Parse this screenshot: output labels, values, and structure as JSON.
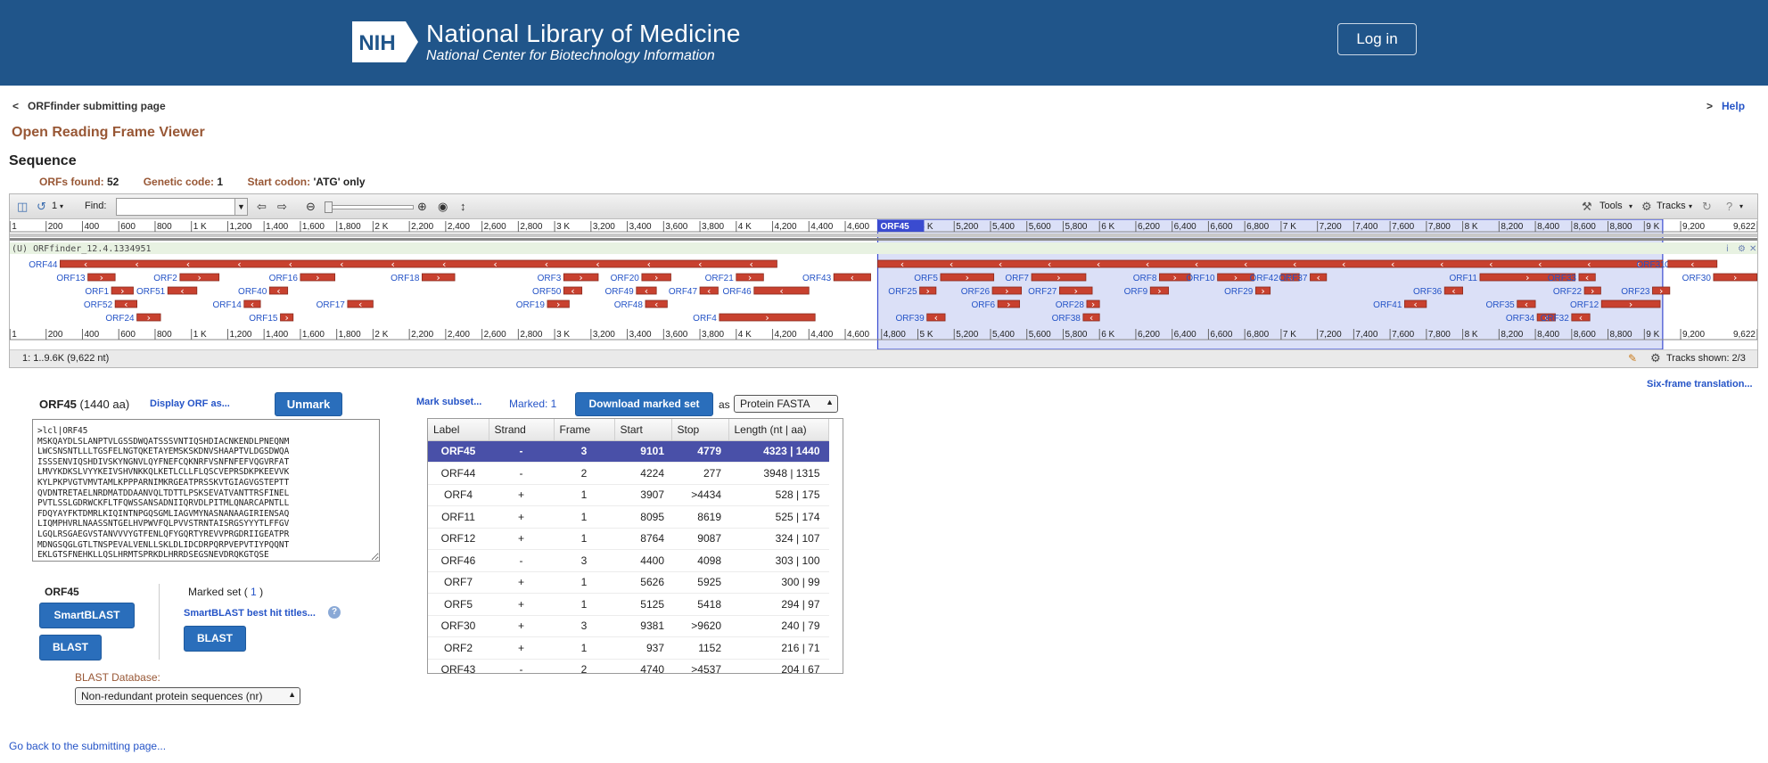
{
  "header": {
    "org_title": "National Library of Medicine",
    "org_subtitle": "National Center for Biotechnology Information",
    "logo_text": "NIH",
    "login_label": "Log in"
  },
  "nav": {
    "back_arrow": "<",
    "back_label": "ORFfinder submitting page",
    "help_arrow": ">",
    "help_label": "Help"
  },
  "page_title": "Open Reading Frame Viewer",
  "section_title": "Sequence",
  "meta": {
    "orfs_found_label": "ORFs found:",
    "orfs_found_value": "52",
    "genetic_code_label": "Genetic code:",
    "genetic_code_value": "1",
    "start_codon_label": "Start codon:",
    "start_codon_value": "'ATG' only"
  },
  "viewer": {
    "toolbar": {
      "undo_count": "1",
      "find_label": "Find:",
      "find_value": "",
      "tools_label": "Tools",
      "tracks_label": "Tracks"
    },
    "ruler_ticks": [
      "1",
      "200",
      "400",
      "600",
      "800",
      "1 K",
      "1,200",
      "1,400",
      "1,600",
      "1,800",
      "2 K",
      "2,200",
      "2,400",
      "2,600",
      "2,800",
      "3 K",
      "3,200",
      "3,400",
      "3,600",
      "3,800",
      "4 K",
      "4,200",
      "4,400",
      "4,600",
      "4,800",
      "5 K",
      "5,200",
      "5,400",
      "5,600",
      "5,800",
      "6 K",
      "6,200",
      "6,400",
      "6,600",
      "6,800",
      "7 K",
      "7,200",
      "7,400",
      "7,600",
      "7,800",
      "8 K",
      "8,200",
      "8,400",
      "8,600",
      "8,800",
      "9 K",
      "9,200",
      "9,622"
    ],
    "sequence_length": 9622,
    "selection": {
      "label": "ORF45",
      "start": 4779,
      "stop": 9101
    },
    "track_title": "(U) ORFfinder_12.4.1334951",
    "status_text": "1: 1..9.6K (9,622 nt)",
    "tracks_shown": "Tracks shown: 2/3",
    "orf_features": [
      {
        "label": "ORF44",
        "start": 277,
        "stop": 4224,
        "row": 0,
        "strand": "-"
      },
      {
        "label": "ORF45",
        "start": 4779,
        "stop": 9101,
        "row": 0,
        "strand": "-"
      },
      {
        "label": "ORF31",
        "start": 9130,
        "stop": 9400,
        "row": 0,
        "strand": "-"
      },
      {
        "label": "ORF13",
        "start": 430,
        "stop": 580,
        "row": 1,
        "strand": "+"
      },
      {
        "label": "ORF2",
        "start": 937,
        "stop": 1152,
        "row": 1,
        "strand": "+"
      },
      {
        "label": "ORF16",
        "start": 1600,
        "stop": 1790,
        "row": 1,
        "strand": "+"
      },
      {
        "label": "ORF18",
        "start": 2270,
        "stop": 2450,
        "row": 1,
        "strand": "+"
      },
      {
        "label": "ORF3",
        "start": 3050,
        "stop": 3240,
        "row": 1,
        "strand": "+"
      },
      {
        "label": "ORF20",
        "start": 3480,
        "stop": 3640,
        "row": 1,
        "strand": "+"
      },
      {
        "label": "ORF21",
        "start": 4000,
        "stop": 4150,
        "row": 1,
        "strand": "+"
      },
      {
        "label": "ORF43",
        "start": 4537,
        "stop": 4740,
        "row": 1,
        "strand": "-"
      },
      {
        "label": "ORF5",
        "start": 5125,
        "stop": 5418,
        "row": 1,
        "strand": "+"
      },
      {
        "label": "ORF7",
        "start": 5626,
        "stop": 5925,
        "row": 1,
        "strand": "+"
      },
      {
        "label": "ORF8",
        "start": 6330,
        "stop": 6500,
        "row": 1,
        "strand": "+"
      },
      {
        "label": "ORF10",
        "start": 6650,
        "stop": 6850,
        "row": 1,
        "strand": "+"
      },
      {
        "label": "ORF42",
        "start": 7000,
        "stop": 7100,
        "row": 1,
        "strand": "-"
      },
      {
        "label": "ORF37",
        "start": 7160,
        "stop": 7250,
        "row": 1,
        "strand": "-"
      },
      {
        "label": "ORF11",
        "start": 8095,
        "stop": 8619,
        "row": 1,
        "strand": "+"
      },
      {
        "label": "ORF33",
        "start": 8640,
        "stop": 8730,
        "row": 1,
        "strand": "-"
      },
      {
        "label": "ORF30",
        "start": 9381,
        "stop": 9620,
        "row": 1,
        "strand": "+"
      },
      {
        "label": "ORF1",
        "start": 560,
        "stop": 680,
        "row": 2,
        "strand": "+"
      },
      {
        "label": "ORF51",
        "start": 870,
        "stop": 1030,
        "row": 2,
        "strand": "-"
      },
      {
        "label": "ORF40",
        "start": 1430,
        "stop": 1530,
        "row": 2,
        "strand": "-"
      },
      {
        "label": "ORF50",
        "start": 3050,
        "stop": 3150,
        "row": 2,
        "strand": "-"
      },
      {
        "label": "ORF49",
        "start": 3450,
        "stop": 3560,
        "row": 2,
        "strand": "-"
      },
      {
        "label": "ORF47",
        "start": 3800,
        "stop": 3900,
        "row": 2,
        "strand": "-"
      },
      {
        "label": "ORF46",
        "start": 4098,
        "stop": 4400,
        "row": 2,
        "strand": "-"
      },
      {
        "label": "ORF25",
        "start": 5010,
        "stop": 5100,
        "row": 2,
        "strand": "+"
      },
      {
        "label": "ORF26",
        "start": 5410,
        "stop": 5570,
        "row": 2,
        "strand": "+"
      },
      {
        "label": "ORF27",
        "start": 5780,
        "stop": 5960,
        "row": 2,
        "strand": "+"
      },
      {
        "label": "ORF9",
        "start": 6280,
        "stop": 6380,
        "row": 2,
        "strand": "+"
      },
      {
        "label": "ORF29",
        "start": 6860,
        "stop": 6940,
        "row": 2,
        "strand": "+"
      },
      {
        "label": "ORF36",
        "start": 7900,
        "stop": 8000,
        "row": 2,
        "strand": "-"
      },
      {
        "label": "ORF22",
        "start": 8670,
        "stop": 8760,
        "row": 2,
        "strand": "+"
      },
      {
        "label": "ORF23",
        "start": 9045,
        "stop": 9140,
        "row": 2,
        "strand": "+"
      },
      {
        "label": "ORF52",
        "start": 580,
        "stop": 700,
        "row": 3,
        "strand": "-"
      },
      {
        "label": "ORF14",
        "start": 1290,
        "stop": 1380,
        "row": 3,
        "strand": "-"
      },
      {
        "label": "ORF17",
        "start": 1860,
        "stop": 2000,
        "row": 3,
        "strand": "-"
      },
      {
        "label": "ORF19",
        "start": 2960,
        "stop": 3080,
        "row": 3,
        "strand": "+"
      },
      {
        "label": "ORF48",
        "start": 3500,
        "stop": 3620,
        "row": 3,
        "strand": "-"
      },
      {
        "label": "ORF6",
        "start": 5440,
        "stop": 5560,
        "row": 3,
        "strand": "+"
      },
      {
        "label": "ORF28",
        "start": 5930,
        "stop": 6000,
        "row": 3,
        "strand": "+"
      },
      {
        "label": "ORF41",
        "start": 7680,
        "stop": 7800,
        "row": 3,
        "strand": "-"
      },
      {
        "label": "ORF35",
        "start": 8300,
        "stop": 8400,
        "row": 3,
        "strand": "-"
      },
      {
        "label": "ORF12",
        "start": 8764,
        "stop": 9087,
        "row": 3,
        "strand": "+"
      },
      {
        "label": "ORF24",
        "start": 700,
        "stop": 830,
        "row": 4,
        "strand": "+"
      },
      {
        "label": "ORF15",
        "start": 1490,
        "stop": 1560,
        "row": 4,
        "strand": "+"
      },
      {
        "label": "ORF4",
        "start": 3907,
        "stop": 4434,
        "row": 4,
        "strand": "+"
      },
      {
        "label": "ORF39",
        "start": 5050,
        "stop": 5150,
        "row": 4,
        "strand": "-"
      },
      {
        "label": "ORF38",
        "start": 5910,
        "stop": 6000,
        "row": 4,
        "strand": "-"
      },
      {
        "label": "ORF34",
        "start": 8410,
        "stop": 8510,
        "row": 4,
        "strand": "-"
      },
      {
        "label": "ORF32",
        "start": 8600,
        "stop": 8700,
        "row": 4,
        "strand": "-"
      }
    ]
  },
  "orf_panel": {
    "orf_name": "ORF45",
    "orf_len": "(1440 aa)",
    "display_link": "Display ORF as...",
    "unmark_label": "Unmark",
    "sequence_text": ">lcl|ORF45\nMSKQAYDLSLANPTVLGSSDWQATSSSVNTIQSHDIACNKENDLPNEQNM\nLWCSNSNTLLLTGSFELNGTQKETAYEMSKSKDNVSHAAPTVLDGSDWQA\nISSSENVIQSHDIVSKYNGNVLQYFNEFCQKNRFVSNFNFEFVQGVRFAT\nLMVYKDKSLVYYKEIVSHVNKKQLKETLCLLFLQSCVEPRSDKPKEEVVK\nKYLPKPVGTVMVTAMLKPPPARNIMKRGEATPRSSKVTGIAGVGSTEPTT\nQVDNTRETAELNRDMATDDAANVQLTDTTLPSKSEVATVANTTRSFINEL\nPVTLSSLGDRWCKFLTFQWSSANSADNIIQRVDLPITMLQNARCAPNTLL\nFDQYAYFKTDMRLKIQINTNPGQSGMLIAGVMYNASNANAAGIRIENSAQ\nLIQMPHVRLNAASSNTGELHVPWVFQLPVVSTRNTAISRGSYYYTLFFGV\nLGQLRSGAEGVSTANVVVYGTFENLQFYGQRTYREVVPRGDRIIGEATPR\nMDNGSQGLGTLTNSPEVALVENLLSKLDLIDCDRPQRPVEPVTIYPQQNT\nEKLGTSFNEHKLLQSLHRMTSPRKDLHRRDSEGSNEVDRQKGTQSE",
    "blast_orf_label": "ORF45",
    "smartblast_label": "SmartBLAST",
    "blast_label": "BLAST",
    "marked_set_label": "Marked set (",
    "marked_set_count": "1",
    "marked_set_close": ")",
    "smartblast_titles": "SmartBLAST best hit titles...",
    "help_symbol": "?",
    "blast_marked_label": "BLAST",
    "blast_db_label": "BLAST Database:",
    "blast_db_value": "Non-redundant protein sequences (nr)"
  },
  "marked_panel": {
    "mark_subset": "Mark subset...",
    "marked_label": "Marked: 1",
    "download_label": "Download marked set",
    "as_label": "as",
    "format_value": "Protein FASTA",
    "six_frame": "Six-frame translation..."
  },
  "orf_table": {
    "columns": [
      "Label",
      "Strand",
      "Frame",
      "Start",
      "Stop",
      "Length (nt | aa)"
    ],
    "rows": [
      {
        "label": "ORF45",
        "strand": "-",
        "frame": "3",
        "start": "9101",
        "stop": "4779",
        "length": "4323 | 1440",
        "selected": true
      },
      {
        "label": "ORF44",
        "strand": "-",
        "frame": "2",
        "start": "4224",
        "stop": "277",
        "length": "3948 | 1315"
      },
      {
        "label": "ORF4",
        "strand": "+",
        "frame": "1",
        "start": "3907",
        "stop": ">4434",
        "length": "528 | 175"
      },
      {
        "label": "ORF11",
        "strand": "+",
        "frame": "1",
        "start": "8095",
        "stop": "8619",
        "length": "525 | 174"
      },
      {
        "label": "ORF12",
        "strand": "+",
        "frame": "1",
        "start": "8764",
        "stop": "9087",
        "length": "324 | 107"
      },
      {
        "label": "ORF46",
        "strand": "-",
        "frame": "3",
        "start": "4400",
        "stop": "4098",
        "length": "303 | 100"
      },
      {
        "label": "ORF7",
        "strand": "+",
        "frame": "1",
        "start": "5626",
        "stop": "5925",
        "length": "300 | 99"
      },
      {
        "label": "ORF5",
        "strand": "+",
        "frame": "1",
        "start": "5125",
        "stop": "5418",
        "length": "294 | 97"
      },
      {
        "label": "ORF30",
        "strand": "+",
        "frame": "3",
        "start": "9381",
        "stop": ">9620",
        "length": "240 | 79"
      },
      {
        "label": "ORF2",
        "strand": "+",
        "frame": "1",
        "start": "937",
        "stop": "1152",
        "length": "216 | 71"
      },
      {
        "label": "ORF43",
        "strand": "-",
        "frame": "2",
        "start": "4740",
        "stop": ">4537",
        "length": "204 | 67"
      }
    ]
  },
  "footer": {
    "go_back": "Go back to the submitting page..."
  },
  "colors": {
    "header_bg": "#20558a",
    "accent_brown": "#985735",
    "link_blue": "#2554c7",
    "button_blue": "#2a6ebb",
    "orf_red": "#c8412f",
    "selection_blue": "#4950a8"
  }
}
